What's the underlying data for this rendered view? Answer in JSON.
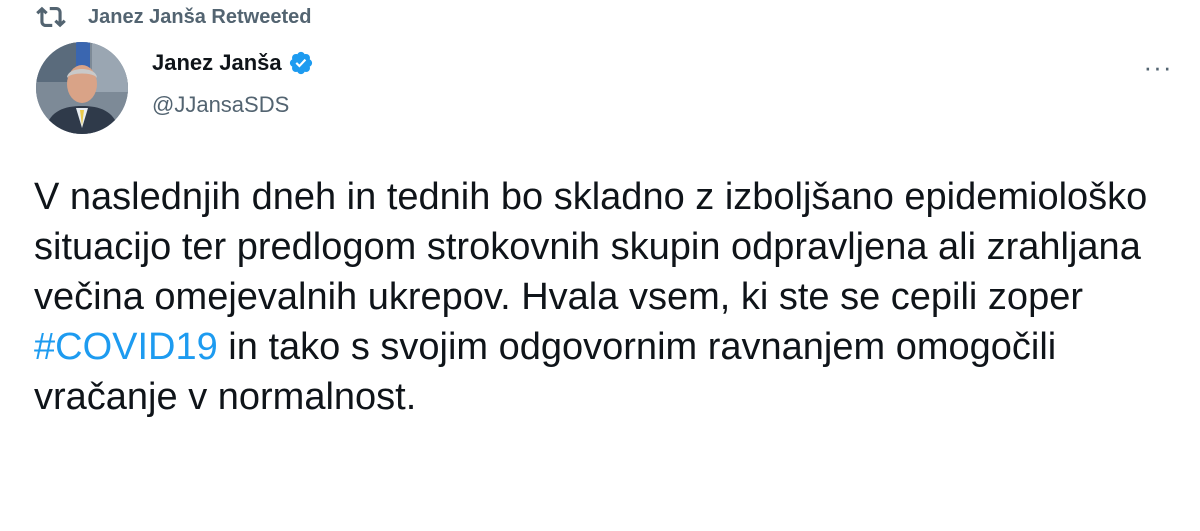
{
  "retweet": {
    "icon": "retweet-icon",
    "label": "Janez Janša Retweeted"
  },
  "author": {
    "name": "Janez Janša",
    "handle": "@JJansaSDS",
    "verified": true,
    "verified_icon": "verified-badge-icon",
    "verified_color": "#1d9bf0"
  },
  "more": {
    "icon": "more-options-icon",
    "label": "···"
  },
  "tweet": {
    "text_part1": "V naslednjih dneh in tednih bo skladno z izboljšano epidemiološko situacijo ter predlogom strokovnih skupin odpravljena ali zrahljana večina omejevalnih ukrepov. Hvala vsem, ki ste se cepili zoper ",
    "hashtag": "#COVID19",
    "text_part2": " in tako s svojim odgovornim ravnanjem omogočili vračanje v normalnost.",
    "hashtag_color": "#1d9bf0"
  }
}
